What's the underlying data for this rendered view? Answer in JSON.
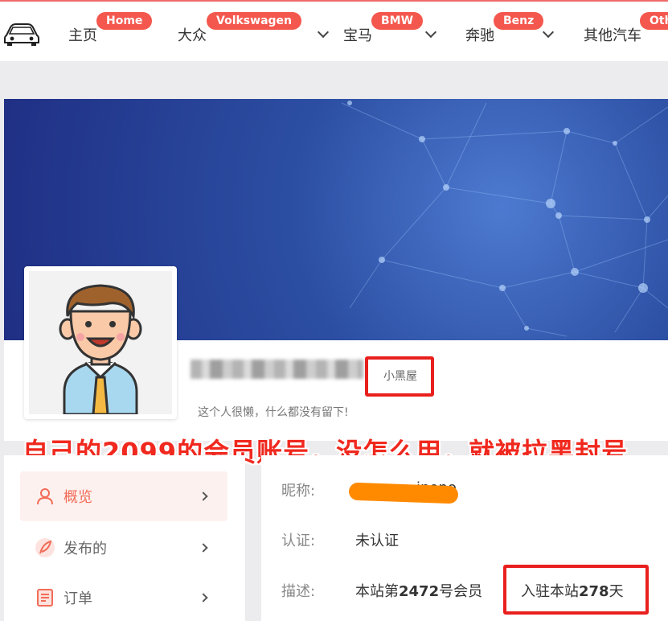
{
  "nav": {
    "items": [
      {
        "label": "主页",
        "badge": "Home",
        "dropdown": false
      },
      {
        "label": "大众",
        "badge": "Volkswagen",
        "dropdown": true
      },
      {
        "label": "宝马",
        "badge": "BMW",
        "dropdown": true
      },
      {
        "label": "奔驰",
        "badge": "Benz",
        "dropdown": true
      },
      {
        "label": "其他汽车",
        "badge": "Oth",
        "dropdown": false
      }
    ]
  },
  "profile": {
    "level": "小黑屋",
    "bio": "这个人很懒，什么都没有留下!"
  },
  "annotation": "自己的2099的会员账号，没怎么用，就被拉黑封号",
  "sidebar": {
    "items": [
      {
        "label": "概览",
        "icon": "user-icon",
        "active": true
      },
      {
        "label": "发布的",
        "icon": "feather-icon",
        "active": false
      },
      {
        "label": "订单",
        "icon": "document-icon",
        "active": false
      }
    ]
  },
  "details": {
    "nickname_label": "昵称:",
    "nickname_visible_tail": "inono",
    "auth_label": "认证:",
    "auth_value": "未认证",
    "desc_label": "描述:",
    "member_prefix": "本站第",
    "member_number": "2472",
    "member_suffix": "号会员",
    "join_prefix": "入驻本站",
    "join_days": "278",
    "join_suffix": "天"
  },
  "colors": {
    "accent": "#f26c57",
    "badge": "#f4574d",
    "annotation_red": "#f0281e",
    "banner_blue": "#2c4fa3"
  }
}
